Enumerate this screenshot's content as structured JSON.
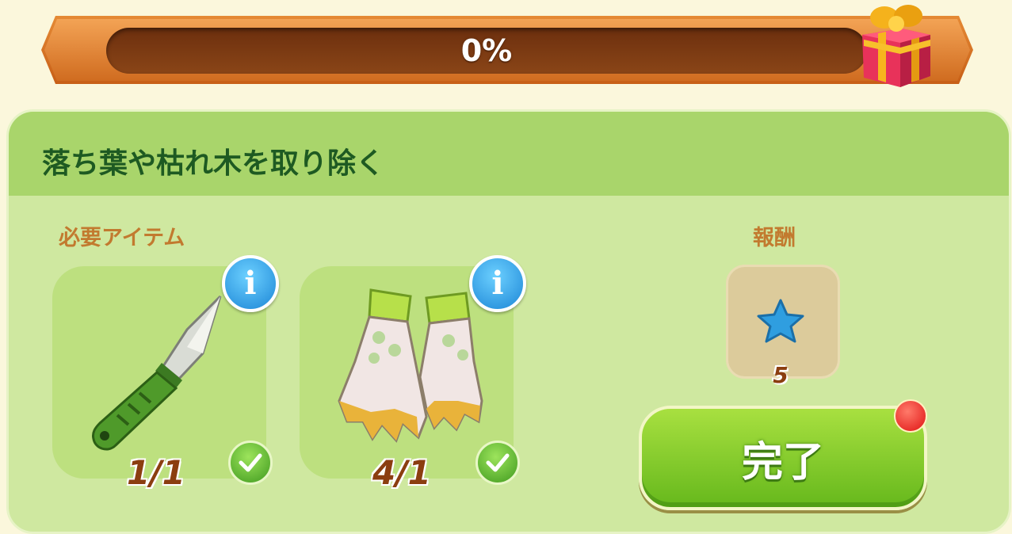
{
  "progress": {
    "value_percent": 0,
    "label": "0%"
  },
  "task": {
    "title": "落ち葉や枯れ木を取り除く"
  },
  "required": {
    "label": "必要アイテム",
    "items": [
      {
        "icon": "knife-icon",
        "count": "1/1",
        "complete": true
      },
      {
        "icon": "gloves-icon",
        "count": "4/1",
        "complete": true
      }
    ]
  },
  "reward": {
    "label": "報酬",
    "icon": "blue-star-icon",
    "count": "5"
  },
  "complete_button": {
    "label": "完了",
    "has_notification": true
  },
  "colors": {
    "progress_frame": "#d06c20",
    "panel": "#cfe8a0",
    "button": "#7cc52a",
    "title": "#1e5a22"
  }
}
